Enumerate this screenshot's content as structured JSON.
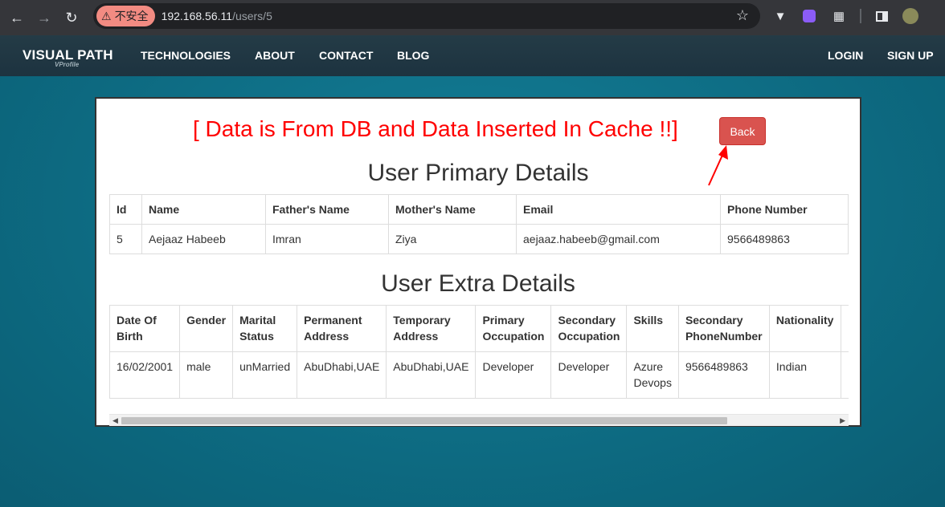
{
  "browser": {
    "security_label": "不安全",
    "url_host": "192.168.56.11",
    "url_path": "/users/5"
  },
  "navbar": {
    "brand": "VISUAL PATH",
    "brand_sub": "VProfile",
    "links": [
      "TECHNOLOGIES",
      "ABOUT",
      "CONTACT",
      "BLOG"
    ],
    "login": "LOGIN",
    "signup": "SIGN UP"
  },
  "page": {
    "headline": "[ Data is From DB and Data Inserted In Cache !!]",
    "back_button": "Back",
    "primary_title": "User Primary Details",
    "extra_title": "User Extra Details",
    "headline_color": "#ff0000",
    "back_color": "#d9534f"
  },
  "primary_table": {
    "headers": [
      "Id",
      "Name",
      "Father's Name",
      "Mother's Name",
      "Email",
      "Phone Number"
    ],
    "row": [
      "5",
      "Aejaaz Habeeb",
      "Imran",
      "Ziya",
      "aejaaz.habeeb@gmail.com",
      "9566489863"
    ]
  },
  "extra_table": {
    "headers": [
      "Date Of Birth",
      "Gender",
      "Marital Status",
      "Permanent Address",
      "Temporary Address",
      "Primary Occupation",
      "Secondary Occupation",
      "Skills",
      "Secondary PhoneNumber",
      "Nationality"
    ],
    "row": [
      "16/02/2001",
      "male",
      "unMarried",
      "AbuDhabi,UAE",
      "AbuDhabi,UAE",
      "Developer",
      "Developer",
      "Azure Devops",
      "9566489863",
      "Indian"
    ]
  }
}
